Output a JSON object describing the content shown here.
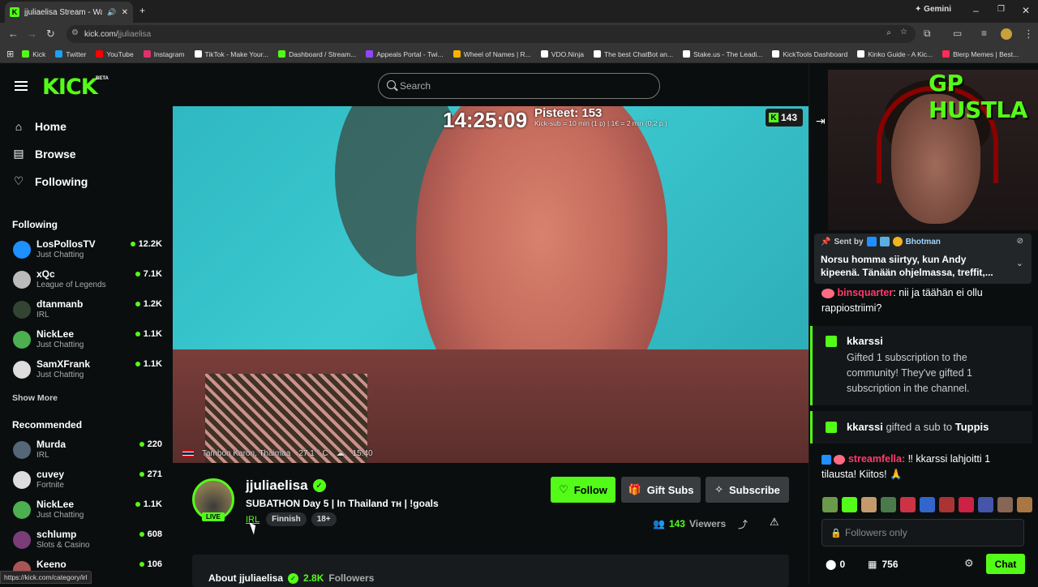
{
  "browser": {
    "tab_title": "jjuliaelisa Stream - Watch L",
    "gemini_label": "Gemini",
    "url_host": "kick.com/",
    "url_path": "jjuliaelisa",
    "bookmarks": [
      {
        "label": "Kick",
        "color": "#53fc18"
      },
      {
        "label": "Twitter",
        "color": "#1da1f2"
      },
      {
        "label": "YouTube",
        "color": "#ff0000"
      },
      {
        "label": "Instagram",
        "color": "#e1306c"
      },
      {
        "label": "TikTok - Make Your...",
        "color": "#ffffff"
      },
      {
        "label": "Dashboard / Stream...",
        "color": "#53fc18"
      },
      {
        "label": "Appeals Portal - Twi...",
        "color": "#9146ff"
      },
      {
        "label": "Wheel of Names | R...",
        "color": "#ffb400"
      },
      {
        "label": "VDO.Ninja",
        "color": "#ffffff"
      },
      {
        "label": "The best ChatBot an...",
        "color": "#ffffff"
      },
      {
        "label": "Stake.us - The Leadi...",
        "color": "#ffffff"
      },
      {
        "label": "KickTools Dashboard",
        "color": "#ffffff"
      },
      {
        "label": "Kinko Guide - A Kic...",
        "color": "#ffffff"
      },
      {
        "label": "Blerp Memes | Best...",
        "color": "#ff2d55"
      }
    ],
    "status_url": "https://kick.com/category/irl"
  },
  "header": {
    "logo": "KICK",
    "logo_beta": "BETA",
    "search_placeholder": "Search"
  },
  "nav": {
    "home": "Home",
    "browse": "Browse",
    "following": "Following"
  },
  "sidebar": {
    "following_title": "Following",
    "following": [
      {
        "name": "LosPollosTV",
        "category": "Just Chatting",
        "viewers": "12.2K",
        "avatar": "#1e90ff"
      },
      {
        "name": "xQc",
        "category": "League of Legends",
        "viewers": "7.1K",
        "avatar": "#bbbbbb"
      },
      {
        "name": "dtanmanb",
        "category": "IRL",
        "viewers": "1.2K",
        "avatar": "#334433"
      },
      {
        "name": "NickLee",
        "category": "Just Chatting",
        "viewers": "1.1K",
        "avatar": "#4caf50"
      },
      {
        "name": "SamXFrank",
        "category": "Just Chatting",
        "viewers": "1.1K",
        "avatar": "#dddddd"
      }
    ],
    "show_more": "Show More",
    "recommended_title": "Recommended",
    "recommended": [
      {
        "name": "Murda",
        "category": "IRL",
        "viewers": "220",
        "avatar": "#556677"
      },
      {
        "name": "cuvey",
        "category": "Fortnite",
        "viewers": "271",
        "avatar": "#dddddd"
      },
      {
        "name": "NickLee",
        "category": "Just Chatting",
        "viewers": "1.1K",
        "avatar": "#4caf50"
      },
      {
        "name": "schlump",
        "category": "Slots & Casino",
        "viewers": "608",
        "avatar": "#7a3d7a"
      },
      {
        "name": "Keeno",
        "category": "Auto V (G...",
        "viewers": "106",
        "avatar": "#aa5555"
      }
    ]
  },
  "video": {
    "clock": "14:25:09",
    "points": "Pisteet: 153",
    "points_sub": "Kick-sub = 10 min (1 p) | 1€ = 2 min (0,2 p.)",
    "badge_count": "143",
    "location": "Tambon Karon, Thaimaa",
    "temperature": "27.1 ° C",
    "time": "15.40"
  },
  "streamer": {
    "live": "LIVE",
    "name": "jjuliaelisa",
    "title": "SUBATHON Day 5 | In Thailand ᴛʜ | !goals",
    "category": "IRL",
    "tags": [
      "Finnish",
      "18+"
    ],
    "follow": "Follow",
    "gift_subs": "Gift Subs",
    "subscribe": "Subscribe",
    "viewers_num": "143",
    "viewers_label": "Viewers",
    "about": "About jjuliaelisa",
    "followers_num": "2.8K",
    "followers_label": "Followers"
  },
  "cam": {
    "title": "GP HUSTLA"
  },
  "chat": {
    "pinned_sent_by": "Sent by",
    "pinned_user": "Bhotman",
    "pinned_msg": "Norsu homma siirtyy, kun Andy kipeenä. Tänään ohjelmassa, treffit,...",
    "msg1_user": "binsquarter",
    "msg1_text": ": nii ja täähän ei ollu rappiostriimi?",
    "gift1_user": "kkarssi",
    "gift1_body": "Gifted 1 subscription to the community! They've gifted 1 subscription in the channel.",
    "gift2_user": "kkarssi",
    "gift2_mid": " gifted a sub to ",
    "gift2_target": "Tuppis",
    "msg2_user": "streamfella:",
    "msg2_text": " ‼ kkarssi lahjoitti 1 tilausta! Kiitos! 🙏",
    "input_placeholder": "Followers only",
    "points_count": "0",
    "gift_count": "756",
    "chat_button": "Chat",
    "emote_colors": [
      "#6a9a4a",
      "#53fc18",
      "#c49a6c",
      "#4a7a4a",
      "#cc3344",
      "#3366cc",
      "#aa3333",
      "#cc2244",
      "#4455aa",
      "#886655",
      "#aa7744"
    ]
  }
}
